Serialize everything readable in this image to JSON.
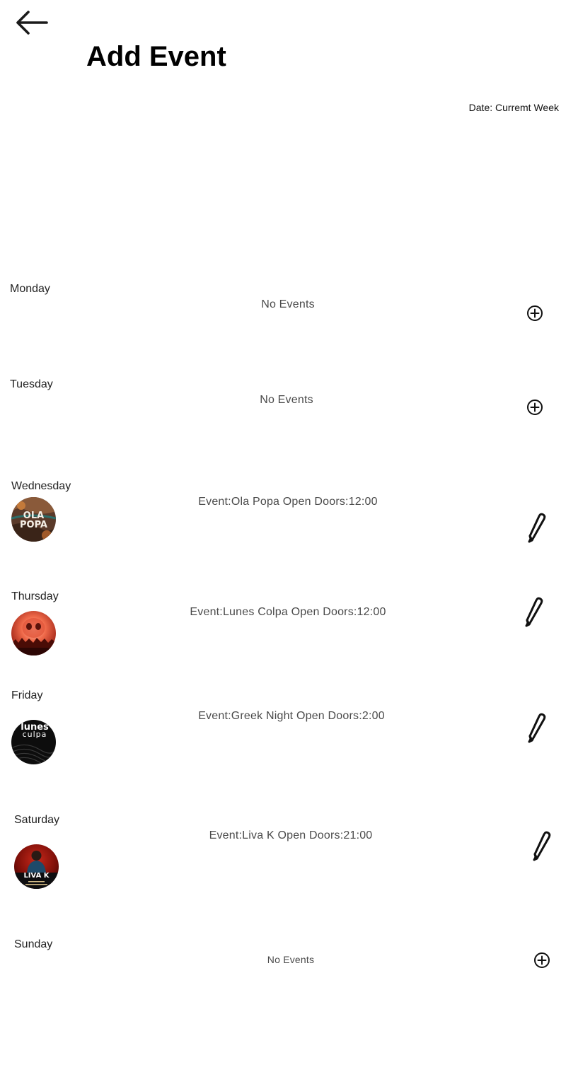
{
  "header": {
    "back_icon": "arrow-left-icon",
    "title": "Add Event",
    "date_label": "Date: Curremt Week"
  },
  "days": [
    {
      "day": "Monday",
      "event": "No Events",
      "action_icon": "add-circle-icon"
    },
    {
      "day": "Tuesday",
      "event": "No Events",
      "action_icon": "add-circle-icon"
    },
    {
      "day": "Wednesday",
      "event": "Event:Ola Popa  Open Doors:12:00",
      "action_icon": "pencil-icon"
    },
    {
      "day": "Thursday",
      "event": "Event:Lunes Colpa  Open Doors:12:00",
      "action_icon": "pencil-icon"
    },
    {
      "day": "Friday",
      "event": "Event:Greek Night  Open Doors:2:00",
      "action_icon": "pencil-icon",
      "thumb_text": [
        "lunes",
        "culpa"
      ]
    },
    {
      "day": "Saturday",
      "event": "Event:Liva K Open Doors:21:00",
      "action_icon": "pencil-icon",
      "thumb_text": [
        "LIVA K"
      ]
    },
    {
      "day": "Sunday",
      "event": "No Events",
      "action_icon": "add-circle-icon"
    }
  ],
  "colors": {
    "text": "#1a1a1a",
    "muted_text": "#4a4a4a",
    "background": "#ffffff"
  }
}
